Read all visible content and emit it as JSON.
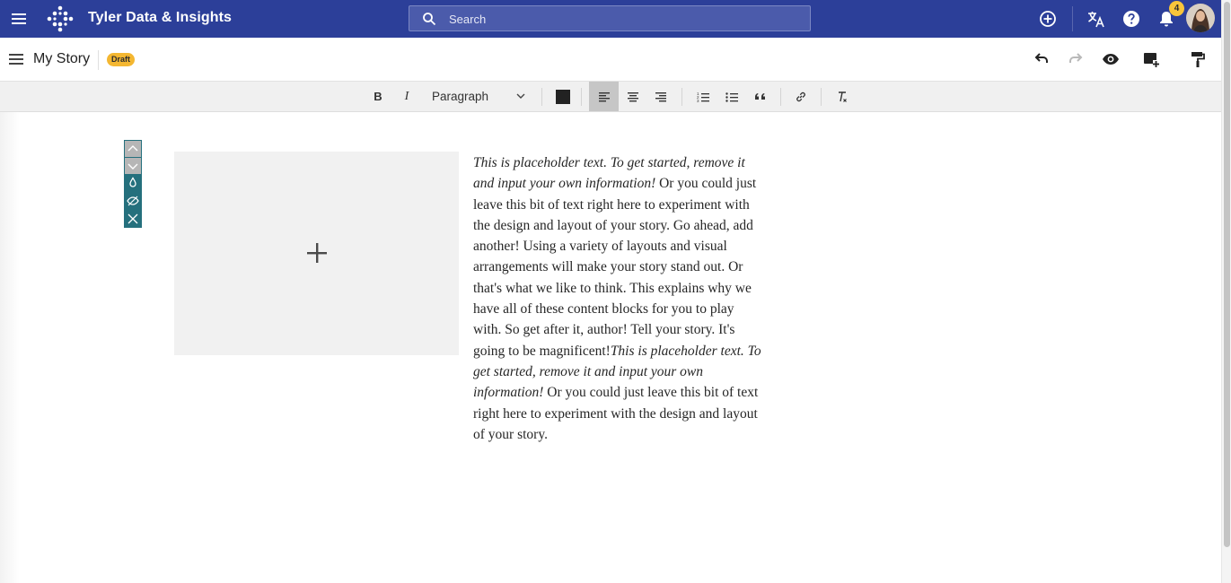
{
  "appbar": {
    "brand": "Tyler Data & Insights",
    "search_placeholder": "Search",
    "notification_count": "4",
    "icons": [
      "menu-icon",
      "logo-icon",
      "search-icon",
      "add-circle-icon",
      "translate-icon",
      "help-icon",
      "bell-icon",
      "avatar"
    ],
    "color": "#2c3f99"
  },
  "subheader": {
    "title": "My Story",
    "status": "Draft",
    "status_color": "#f4b731",
    "icons": [
      "hamburger-icon",
      "undo-icon",
      "redo-icon",
      "preview-eye-icon",
      "add-block-icon",
      "format-paint-icon"
    ]
  },
  "toolbar": {
    "bold": "B",
    "italic": "I",
    "paragraph_style": "Paragraph",
    "text_color": "#222222",
    "active_alignment": "align-left",
    "buttons": [
      "bold",
      "italic",
      "paragraph-select",
      "text-color",
      "align-left",
      "align-center",
      "align-right",
      "ordered-list",
      "bulleted-list",
      "blockquote",
      "link",
      "clear-formatting"
    ]
  },
  "block": {
    "controls": [
      "move-up-icon",
      "move-down-icon",
      "color-drop-icon",
      "hide-icon",
      "delete-icon"
    ],
    "controls_color": "#25707d",
    "image_placeholder_icon": "plus-icon",
    "text": {
      "p1_italic": "This is placeholder text. To get started, remove it and input your own information!",
      "p1_rest": " Or you could just leave this bit of text right here to experiment with the design and layout of your story. Go ahead, add another! Using a variety of layouts and visual arrangements will make your story stand out. Or that's what we like to think. This explains why we have all of these content blocks for you to play with. So get after it, author! Tell your story. It's going to be magnificent!",
      "p2_italic": "This is placeholder text. To get started, remove it and input your own information!",
      "p2_rest": " Or you could just leave this bit of text right here to experiment with the design and layout of your story."
    }
  }
}
